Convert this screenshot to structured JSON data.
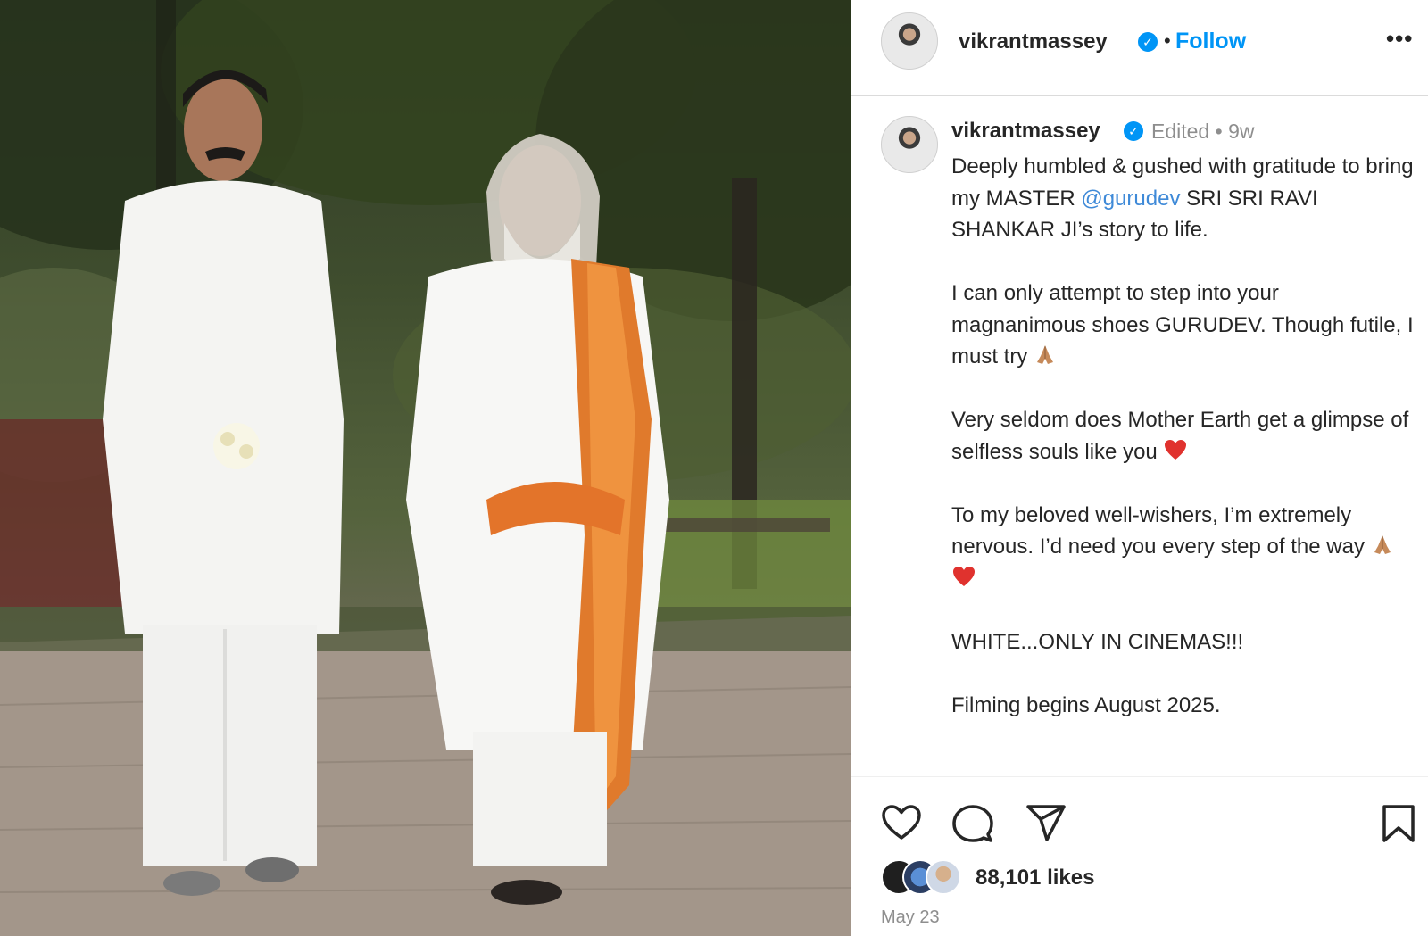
{
  "header": {
    "username": "vikrantmassey",
    "separator": "•",
    "follow_label": "Follow",
    "more_label": "•••"
  },
  "caption": {
    "username": "vikrantmassey",
    "edited_label": "Edited",
    "separator": "•",
    "time_ago": "9w",
    "para1_before": "Deeply humbled & gushed with gratitude to bring my MASTER ",
    "mention": "@gurudev",
    "para1_after": " SRI SRI RAVI SHANKAR JI’s story to life.",
    "para2": "I can only attempt to step into your magnanimous shoes GURUDEV. Though futile, I must try",
    "para3": "Very seldom does Mother Earth get a glimpse of selfless souls like you",
    "para4": "To my beloved well-wishers, I’m extremely nervous. I’d need you every step of the way",
    "para5": "WHITE...ONLY IN CINEMAS!!!",
    "para6": "Filming begins August 2025."
  },
  "actions": {
    "icons": [
      "heart-icon",
      "comment-icon",
      "share-icon",
      "bookmark-icon"
    ]
  },
  "likes": {
    "count_label": "88,101 likes"
  },
  "post_date": "May 23",
  "colors": {
    "accent": "#0095f6",
    "mention": "#3f8ad8",
    "muted": "#8e8e8e",
    "text": "#262626"
  }
}
